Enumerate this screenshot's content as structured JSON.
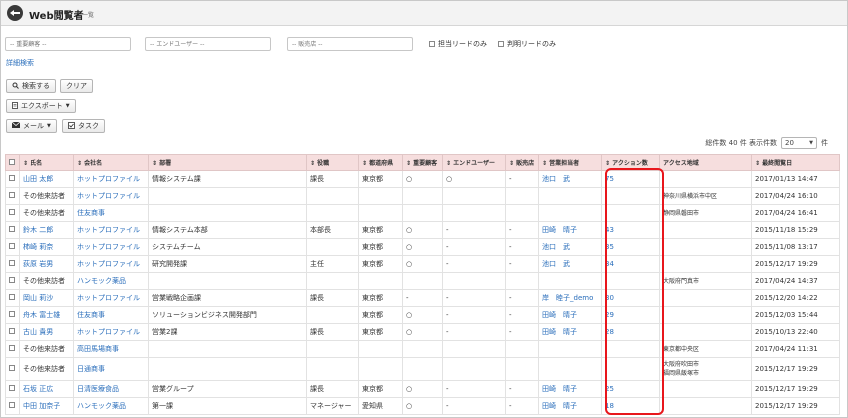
{
  "header": {
    "title": "Web閲覧者",
    "subtitle": "一覧"
  },
  "filters": {
    "important_customer_placeholder": "-- 重要顧客 --",
    "end_user_placeholder": "-- エンドユーザー --",
    "dealer_placeholder": "-- 販売店 --",
    "owner_leads_label": "担当リードのみ",
    "identified_leads_label": "判明リードのみ",
    "detail_search_link": "詳細検索"
  },
  "toolbar": {
    "search_label": "検索する",
    "clear_label": "クリア",
    "export_label": "エクスポート",
    "mail_label": "メール",
    "task_label": "タスク"
  },
  "paging": {
    "total_label": "総件数 40 件 表示件数",
    "per_page": "20",
    "suffix": "件"
  },
  "table": {
    "columns": [
      "氏名",
      "会社名",
      "部署",
      "役職",
      "都道府県",
      "重要顧客",
      "エンドユーザー",
      "販売店",
      "営業担当者",
      "アクション数",
      "アクセス地域",
      "最終閲覧日"
    ],
    "rows": [
      {
        "name": "山田 太郎",
        "company": "ホットプロファイル",
        "dept": "情報システム課",
        "title": "課長",
        "pref": "東京都",
        "important": "○",
        "enduser": "○",
        "dealer": "-",
        "rep": "池口　武",
        "actions": "75",
        "region": "",
        "date": "2017/01/13 14:47"
      },
      {
        "name": "その他来訪者",
        "company": "ホットプロファイル",
        "dept": "",
        "title": "",
        "pref": "",
        "important": "",
        "enduser": "",
        "dealer": "",
        "rep": "",
        "actions": "",
        "region": "神奈川県横浜市中区",
        "date": "2017/04/24 16:10"
      },
      {
        "name": "その他来訪者",
        "company": "住友商事",
        "dept": "",
        "title": "",
        "pref": "",
        "important": "",
        "enduser": "",
        "dealer": "",
        "rep": "",
        "actions": "",
        "region": "静岡県磐田市",
        "date": "2017/04/24 16:41"
      },
      {
        "name": "鈴木 二郎",
        "company": "ホットプロファイル",
        "dept": "情報システム本部",
        "title": "本部長",
        "pref": "東京都",
        "important": "○",
        "enduser": "-",
        "dealer": "-",
        "rep": "田崎　晴子",
        "actions": "43",
        "region": "",
        "date": "2015/11/18 15:29"
      },
      {
        "name": "柿崎 莉奈",
        "company": "ホットプロファイル",
        "dept": "システムチーム",
        "title": "",
        "pref": "東京都",
        "important": "○",
        "enduser": "-",
        "dealer": "-",
        "rep": "池口　武",
        "actions": "35",
        "region": "",
        "date": "2015/11/08 13:17"
      },
      {
        "name": "荻原 岩男",
        "company": "ホットプロファイル",
        "dept": "研究開発課",
        "title": "主任",
        "pref": "東京都",
        "important": "○",
        "enduser": "-",
        "dealer": "-",
        "rep": "池口　武",
        "actions": "34",
        "region": "",
        "date": "2015/12/17 19:29"
      },
      {
        "name": "その他来訪者",
        "company": "ハンモック薬品",
        "dept": "",
        "title": "",
        "pref": "",
        "important": "",
        "enduser": "",
        "dealer": "",
        "rep": "",
        "actions": "",
        "region": "大阪府門真市",
        "date": "2017/04/24 14:37"
      },
      {
        "name": "岡山 莉沙",
        "company": "ホットプロファイル",
        "dept": "営業戦略企画課",
        "title": "課長",
        "pref": "東京都",
        "important": "-",
        "enduser": "-",
        "dealer": "-",
        "rep": "岸　睦子_demo",
        "actions": "30",
        "region": "",
        "date": "2015/12/20 14:22"
      },
      {
        "name": "舟木 富士雄",
        "company": "住友商事",
        "dept": "ソリューションビジネス開発部門",
        "title": "",
        "pref": "東京都",
        "important": "○",
        "enduser": "-",
        "dealer": "-",
        "rep": "田崎　晴子",
        "actions": "29",
        "region": "",
        "date": "2015/12/03 15:44"
      },
      {
        "name": "古山 貴男",
        "company": "ホットプロファイル",
        "dept": "営業2課",
        "title": "課長",
        "pref": "東京都",
        "important": "○",
        "enduser": "-",
        "dealer": "-",
        "rep": "田崎　晴子",
        "actions": "28",
        "region": "",
        "date": "2015/10/13 22:40"
      },
      {
        "name": "その他来訪者",
        "company": "高田馬場商事",
        "dept": "",
        "title": "",
        "pref": "",
        "important": "",
        "enduser": "",
        "dealer": "",
        "rep": "",
        "actions": "",
        "region": "東京都中央区",
        "date": "2017/04/24 11:31"
      },
      {
        "name": "その他来訪者",
        "company": "日通商事",
        "dept": "",
        "title": "",
        "pref": "",
        "important": "",
        "enduser": "",
        "dealer": "",
        "rep": "",
        "actions": "",
        "region": "大阪府吹田市\n福岡県飯塚市",
        "date": "2015/12/17 19:29"
      },
      {
        "name": "石坂 正広",
        "company": "日清医療食品",
        "dept": "営業グループ",
        "title": "課長",
        "pref": "東京都",
        "important": "○",
        "enduser": "-",
        "dealer": "-",
        "rep": "田崎　晴子",
        "actions": "25",
        "region": "",
        "date": "2015/12/17 19:29"
      },
      {
        "name": "中田 加奈子",
        "company": "ハンモック薬品",
        "dept": "第一課",
        "title": "マネージャー",
        "pref": "愛知県",
        "important": "○",
        "enduser": "-",
        "dealer": "-",
        "rep": "田崎　晴子",
        "actions": "18",
        "region": "",
        "date": "2015/12/17 19:29"
      }
    ]
  }
}
